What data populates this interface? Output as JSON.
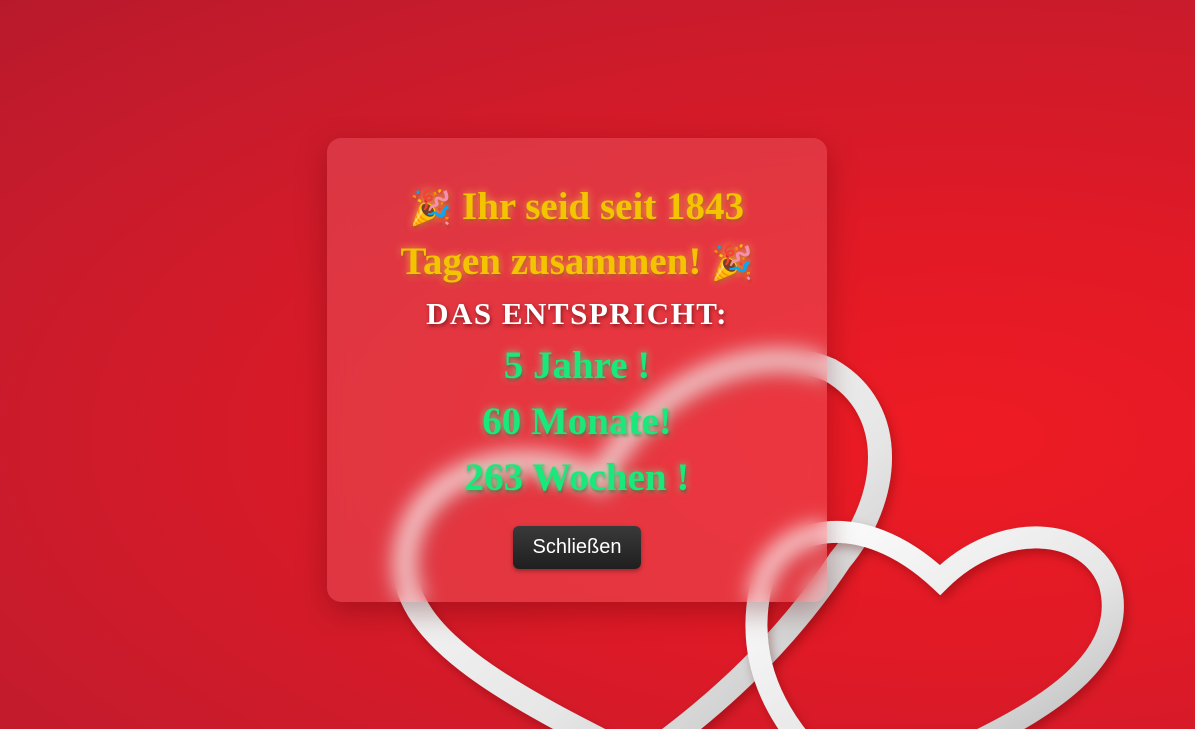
{
  "background": {
    "colors": {
      "center": "#ee1b24",
      "edge": "#b81a2c"
    },
    "decoration": "two-hearts-outline"
  },
  "modal": {
    "title_emoji_left": "🎉",
    "title_text": "Ihr seid seit 1843 Tagen zusammen!",
    "title_emoji_right": "🎉",
    "subtitle": "DAS ENTSPRICHT:",
    "stats": [
      "5 Jahre !",
      "60 Monate!",
      "263 Wochen !"
    ],
    "close_label": "Schließen",
    "colors": {
      "title": "#f5c400",
      "subtitle": "#ffffff",
      "stats": "#19e87a",
      "button": "#2a2a2a"
    }
  }
}
